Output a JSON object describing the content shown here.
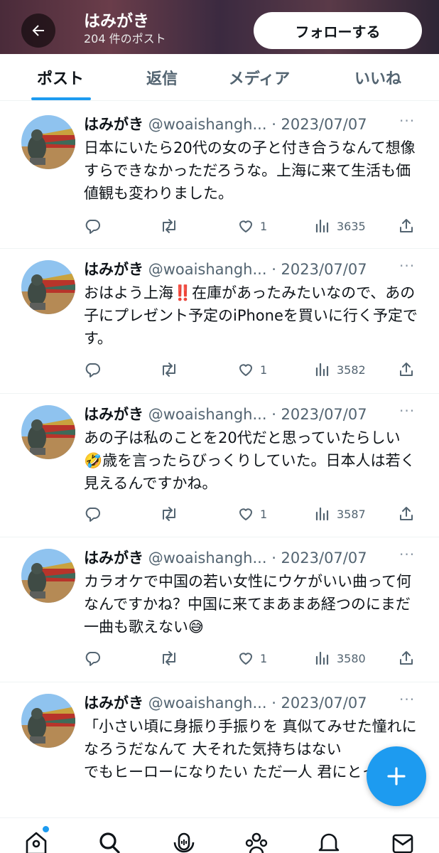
{
  "header": {
    "title": "はみがき",
    "post_count": "204 件のポスト",
    "follow_label": "フォローする"
  },
  "tabs": [
    "ポスト",
    "返信",
    "メディア",
    "いいね"
  ],
  "posts": [
    {
      "name": "はみがき",
      "handle": "@woaishangh...",
      "date": "· 2023/07/07",
      "text": "日本にいたら20代の女の子と付き合うなんて想像すらできなかっただろうな。上海に来て生活も価値観も変わりました。",
      "likes": "1",
      "views": "3635"
    },
    {
      "name": "はみがき",
      "handle": "@woaishangh...",
      "date": "· 2023/07/07",
      "text": "おはよう上海‼️在庫があったみたいなので、あの子にプレゼント予定のiPhoneを買いに行く予定です。",
      "likes": "1",
      "views": "3582"
    },
    {
      "name": "はみがき",
      "handle": "@woaishangh...",
      "date": "· 2023/07/07",
      "text": "あの子は私のことを20代だと思っていたらしい🤣歳を言ったらびっくりしていた。日本人は若く見えるんですかね。",
      "likes": "1",
      "views": "3587"
    },
    {
      "name": "はみがき",
      "handle": "@woaishangh...",
      "date": "· 2023/07/07",
      "text": "カラオケで中国の若い女性にウケがいい曲って何なんですかね？中国に来てまあまあ経つのにまだ一曲も歌えない😅",
      "likes": "1",
      "views": "3580"
    },
    {
      "name": "はみがき",
      "handle": "@woaishangh...",
      "date": "· 2023/07/07",
      "text": "「小さい頃に身振り手振りを 真似てみせた憧れになろうだなんて 大それた気持ちはない\nでもヒーローになりたい ただ一人 君にとっての"
    }
  ],
  "more_glyph": "···",
  "icons": {
    "back": "back-arrow-icon",
    "reply": "reply-icon",
    "repost": "repost-icon",
    "like": "heart-icon",
    "views": "views-icon",
    "share": "share-icon",
    "compose": "plus-icon",
    "nav": [
      "home-icon",
      "search-icon",
      "spaces-icon",
      "communities-icon",
      "notifications-icon",
      "messages-icon"
    ]
  },
  "colors": {
    "accent": "#1d9bf0",
    "text": "#0f1419",
    "muted": "#536471"
  }
}
